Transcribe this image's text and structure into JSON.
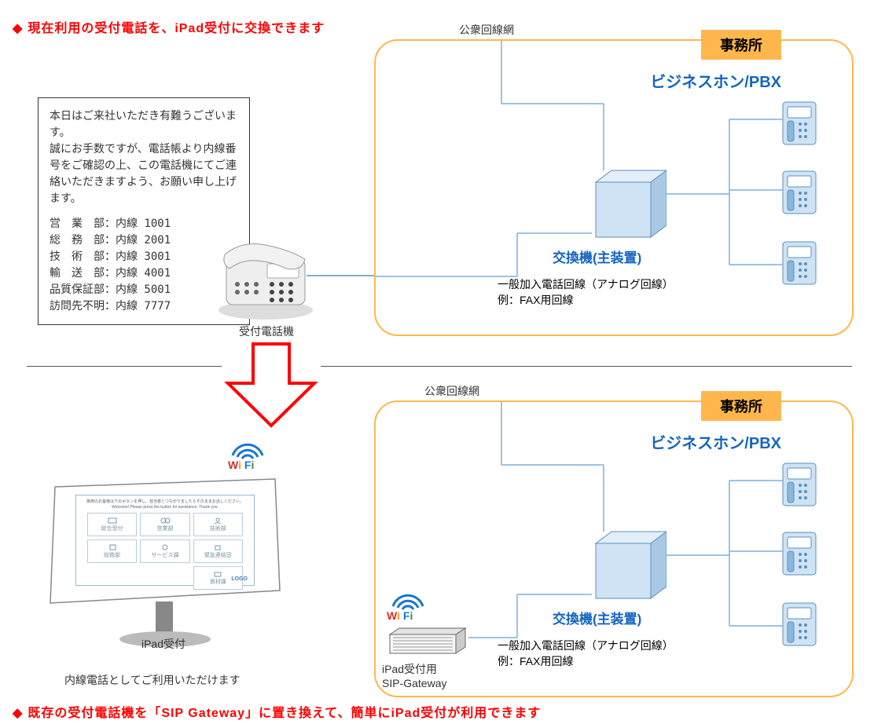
{
  "headline_top": "現在利用の受付電話を、iPad受付に交換できます",
  "headline_bottom": "既存の受付電話機を「SIP Gateway」に置き換えて、簡単にiPad受付が利用できます",
  "public_line_label": "公衆回線網",
  "office_label": "事務所",
  "pbx_title": "ビジネスホン/PBX",
  "exchange_label": "交換機(主装置)",
  "analog_line1": "一般加入電話回線（アナログ回線）",
  "analog_line2": "例：FAX用回線",
  "sign": {
    "intro1": "本日はご来社いただき有難うございます。",
    "intro2": "誠にお手数ですが、電話帳より内線番号をご確認の上、この電話機にてご連絡いただきますよう、お願い申し上げます。",
    "rows": [
      {
        "dept": "営　業　部",
        "ext": "：内線 1001"
      },
      {
        "dept": "総　務　部",
        "ext": "：内線 2001"
      },
      {
        "dept": "技　術　部",
        "ext": "：内線 3001"
      },
      {
        "dept": "輸　送　部",
        "ext": "：内線 4001"
      },
      {
        "dept": "品質保証部",
        "ext": "：内線 5001"
      },
      {
        "dept": "訪問先不明",
        "ext": "：内線 7777"
      }
    ]
  },
  "reception_phone_label": "受付電話機",
  "ipad_label": "iPad受付",
  "ipad_note": "内線電話としてご利用いただけます",
  "sip_label1": "iPad受付用",
  "sip_label2": "SIP-Gateway",
  "wifi_text": "Wi Fi",
  "ipad_screen": {
    "header_jp": "御用のお客様は下のボタンを押し、担当者とつながりましたらそのままお話しください。",
    "header_en": "Welcome! Please press the button for assistance. Thank you.",
    "buttons": [
      "総合受付",
      "営業部",
      "技術部",
      "総務部",
      "サービス課",
      "緊急連絡窓",
      "資材課"
    ],
    "logo": "LOGO"
  }
}
